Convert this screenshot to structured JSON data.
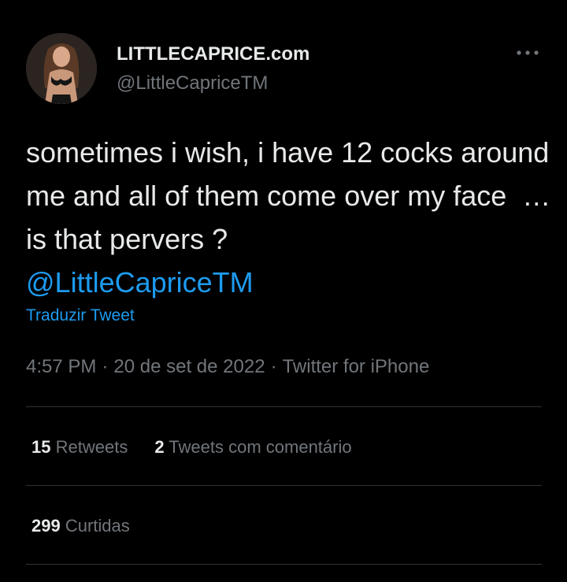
{
  "author": {
    "display_name": "LITTLECAPRICE.com",
    "handle": "@LittleCapriceTM",
    "avatar_icon": "profile-photo"
  },
  "more_icon": "more-horizontal-icon",
  "tweet": {
    "text": "sometimes i wish, i have 12 cocks around me and all of them come over my face  … is that pervers ?",
    "mention": "@LittleCapriceTM"
  },
  "translate_label": "Traduzir Tweet",
  "meta": {
    "time": "4:57 PM",
    "date": "20 de set de 2022",
    "source": "Twitter for iPhone",
    "separator": "·"
  },
  "stats": {
    "retweets_count": "15",
    "retweets_label": "Retweets",
    "quotes_count": "2",
    "quotes_label": "Tweets com comentário",
    "likes_count": "299",
    "likes_label": "Curtidas"
  },
  "colors": {
    "background": "#000000",
    "text": "#e7e9ea",
    "secondary": "#71767b",
    "accent": "#1d9bf0",
    "divider": "#2f3336"
  }
}
